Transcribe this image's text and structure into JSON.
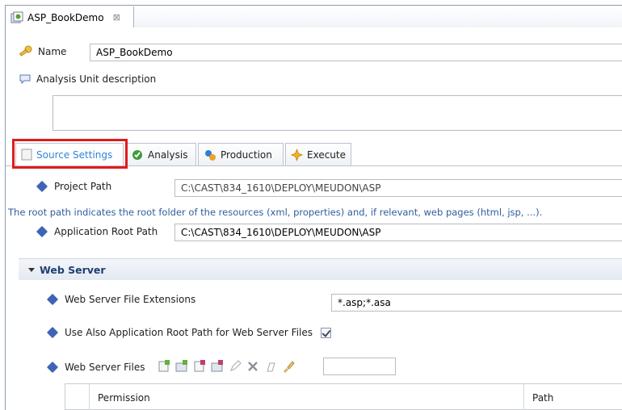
{
  "editor_tab": {
    "title": "ASP_BookDemo",
    "close": "⊠"
  },
  "name": {
    "label": "Name",
    "value": "ASP_BookDemo"
  },
  "description": {
    "label": "Analysis Unit description",
    "value": ""
  },
  "subtabs": [
    {
      "label": "Source Settings",
      "active": true
    },
    {
      "label": "Analysis",
      "active": false
    },
    {
      "label": "Production",
      "active": false
    },
    {
      "label": "Execute",
      "active": false
    }
  ],
  "project_path": {
    "label": "Project Path",
    "value": "C:\\CAST\\834_1610\\DEPLOY\\MEUDON\\ASP"
  },
  "hint": "The root path indicates the root folder of the resources (xml, properties) and, if relevant, web pages (html, jsp, ...).",
  "app_root_path": {
    "label": "Application Root Path",
    "value": "C:\\CAST\\834_1610\\DEPLOY\\MEUDON\\ASP"
  },
  "web_server": {
    "section_title": "Web Server",
    "file_ext": {
      "label": "Web Server File Extensions",
      "value": "*.asp;*.asa"
    },
    "use_root": {
      "label": "Use Also Application Root Path for Web Server Files",
      "checked": true
    },
    "files": {
      "label": "Web Server Files"
    },
    "table_headers": [
      "Permission",
      "Path"
    ]
  },
  "colors": {
    "accent": "#2f86d8",
    "highlight": "#e21b1b",
    "diamond": "#3f64b5"
  }
}
